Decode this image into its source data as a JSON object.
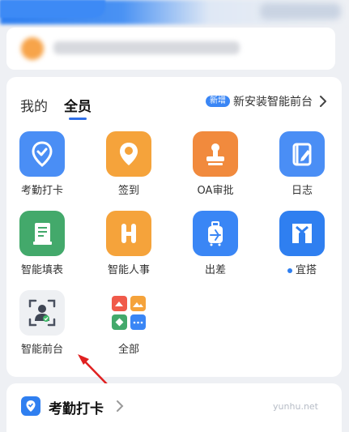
{
  "tabs": [
    {
      "label": "我的"
    },
    {
      "label": "全员"
    }
  ],
  "promo": {
    "badge": "新增",
    "text": "新安装智能前台"
  },
  "apps": [
    {
      "label": "考勤打卡",
      "icon": "location-check-icon",
      "color": "#4a8ef5"
    },
    {
      "label": "签到",
      "icon": "location-pin-icon",
      "color": "#f5a33b"
    },
    {
      "label": "OA审批",
      "icon": "stamp-icon",
      "color": "#f18a3d"
    },
    {
      "label": "日志",
      "icon": "notebook-pen-icon",
      "color": "#4a8ef5"
    },
    {
      "label": "智能填表",
      "icon": "form-list-icon",
      "color": "#43a96b"
    },
    {
      "label": "智能人事",
      "icon": "hr-h-icon",
      "color": "#f5a33b"
    },
    {
      "label": "出差",
      "icon": "suitcase-plane-icon",
      "color": "#3a86f5"
    },
    {
      "label": "宜搭",
      "icon": "yida-logo-icon",
      "color": "#2f7ff0"
    },
    {
      "label": "智能前台",
      "icon": "face-scan-icon",
      "color": "#eef0f3"
    },
    {
      "label": "全部",
      "icon": "all-apps-icon",
      "color": "#ffffff"
    }
  ],
  "bottom": {
    "title": "考勤打卡"
  },
  "watermark": "yunhu.net",
  "colors": {
    "accent": "#2f7ff0",
    "annotation_arrow": "#e02020"
  }
}
